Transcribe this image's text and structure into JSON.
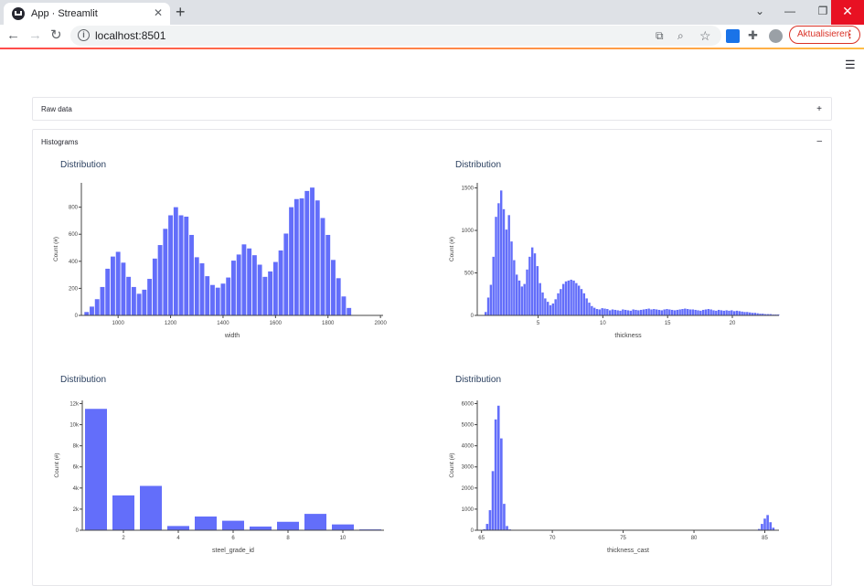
{
  "browser": {
    "tab_title": "App · Streamlit",
    "url": "localhost:8501",
    "update_label": "Aktualisieren",
    "icons": [
      "streamlit-icon",
      "close-icon",
      "plus-icon",
      "back-icon",
      "forward-icon",
      "reload-icon",
      "info-icon",
      "translate-icon",
      "zoom-icon",
      "star-icon",
      "extension-icon",
      "puzzle-icon",
      "profile-icon",
      "more-icon",
      "minimize-icon",
      "restore-icon",
      "chevron-down-icon"
    ]
  },
  "app": {
    "menu_icon": "hamburger-icon",
    "expanders": [
      {
        "label": "Raw data",
        "toggle": "+"
      },
      {
        "label": "Histograms",
        "toggle": "–"
      }
    ]
  },
  "chart_data": [
    {
      "type": "bar",
      "title": "Distribution",
      "xlabel": "width",
      "ylabel": "Count (#)",
      "color": "#636efa",
      "x_start": 870,
      "bin_width": 20,
      "values": [
        25,
        65,
        120,
        210,
        345,
        435,
        470,
        390,
        285,
        210,
        160,
        190,
        270,
        420,
        520,
        640,
        740,
        800,
        740,
        730,
        595,
        430,
        385,
        290,
        225,
        205,
        235,
        280,
        405,
        450,
        525,
        495,
        445,
        375,
        285,
        325,
        395,
        480,
        605,
        800,
        860,
        865,
        920,
        945,
        850,
        720,
        595,
        410,
        275,
        140,
        55
      ],
      "xlim": [
        860,
        2010
      ],
      "ylim": [
        0,
        980
      ],
      "x_ticks": [
        1000,
        1200,
        1400,
        1600,
        1800,
        2000
      ],
      "y_ticks": [
        0,
        200,
        400,
        600,
        800
      ]
    },
    {
      "type": "bar",
      "title": "Distribution",
      "xlabel": "thickness",
      "ylabel": "Count (#)",
      "color": "#636efa",
      "x_start": 0.85,
      "bin_width": 0.2,
      "values": [
        40,
        210,
        360,
        690,
        1160,
        1320,
        1470,
        1250,
        1010,
        1180,
        870,
        650,
        480,
        410,
        340,
        370,
        540,
        690,
        800,
        730,
        580,
        380,
        270,
        200,
        160,
        120,
        140,
        190,
        260,
        310,
        370,
        400,
        410,
        420,
        410,
        380,
        350,
        310,
        260,
        200,
        150,
        110,
        90,
        75,
        70,
        85,
        80,
        75,
        60,
        70,
        65,
        60,
        55,
        70,
        65,
        60,
        55,
        70,
        65,
        60,
        65,
        70,
        75,
        80,
        70,
        75,
        70,
        65,
        60,
        70,
        75,
        70,
        65,
        60,
        65,
        70,
        75,
        80,
        75,
        70,
        70,
        65,
        60,
        55,
        65,
        70,
        75,
        70,
        60,
        55,
        65,
        60,
        55,
        60,
        55,
        60,
        50,
        55,
        50,
        45,
        40,
        40,
        35,
        30,
        30,
        25,
        20,
        20,
        15,
        15,
        15,
        10,
        10,
        10
      ],
      "xlim": [
        0.3,
        23.6
      ],
      "ylim": [
        0,
        1560
      ],
      "x_ticks": [
        5,
        10,
        15,
        20
      ],
      "y_ticks": [
        0,
        500,
        1000,
        1500
      ]
    },
    {
      "type": "bar",
      "title": "Distribution",
      "xlabel": "steel_grade_id",
      "ylabel": "Count (#)",
      "color": "#636efa",
      "categories": [
        1,
        2,
        3,
        4,
        5,
        6,
        7,
        8,
        9,
        10,
        11
      ],
      "values": [
        11500,
        3300,
        4200,
        400,
        1300,
        900,
        350,
        800,
        1550,
        550,
        80
      ],
      "xlim": [
        0.5,
        11.5
      ],
      "ylim": [
        0,
        12300
      ],
      "x_ticks": [
        2,
        4,
        6,
        8,
        10
      ],
      "y_ticks": [
        0,
        2000,
        4000,
        6000,
        8000,
        10000,
        12000
      ],
      "y_tick_labels": [
        "0",
        "2k",
        "4k",
        "6k",
        "8k",
        "10k",
        "12k"
      ]
    },
    {
      "type": "bar",
      "title": "Distribution",
      "xlabel": "thickness_cast",
      "ylabel": "Count (#)",
      "color": "#636efa",
      "bins": [
        {
          "x": 65.2,
          "y": 50
        },
        {
          "x": 65.4,
          "y": 300
        },
        {
          "x": 65.6,
          "y": 950
        },
        {
          "x": 65.8,
          "y": 2800
        },
        {
          "x": 66.0,
          "y": 5250
        },
        {
          "x": 66.2,
          "y": 5900
        },
        {
          "x": 66.4,
          "y": 4350
        },
        {
          "x": 66.6,
          "y": 1250
        },
        {
          "x": 66.8,
          "y": 200
        },
        {
          "x": 67.0,
          "y": 40
        },
        {
          "x": 84.6,
          "y": 60
        },
        {
          "x": 84.8,
          "y": 300
        },
        {
          "x": 85.0,
          "y": 550
        },
        {
          "x": 85.2,
          "y": 720
        },
        {
          "x": 85.4,
          "y": 380
        },
        {
          "x": 85.6,
          "y": 120
        }
      ],
      "bin_width": 0.2,
      "xlim": [
        64.7,
        86.0
      ],
      "ylim": [
        0,
        6150
      ],
      "x_ticks": [
        65,
        70,
        75,
        80,
        85
      ],
      "y_ticks": [
        0,
        1000,
        2000,
        3000,
        4000,
        5000,
        6000
      ]
    }
  ]
}
